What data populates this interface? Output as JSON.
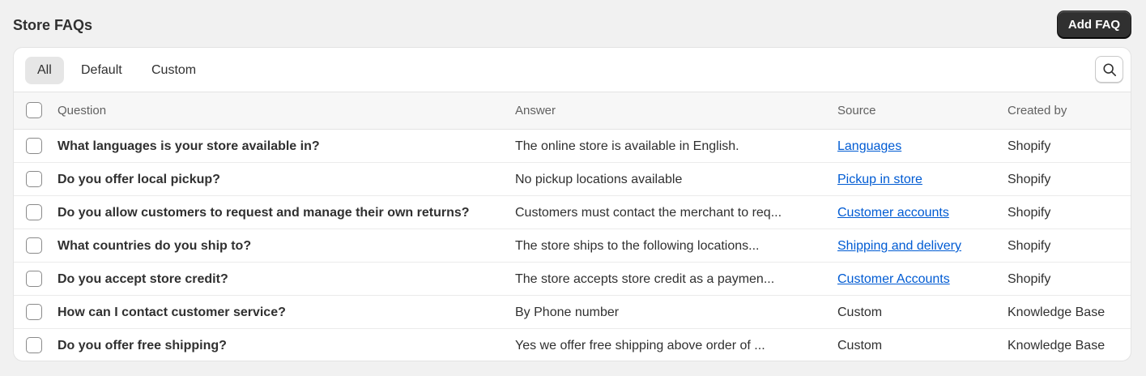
{
  "header": {
    "title": "Store FAQs",
    "add_button": "Add FAQ"
  },
  "tabs": [
    {
      "label": "All",
      "active": true
    },
    {
      "label": "Default",
      "active": false
    },
    {
      "label": "Custom",
      "active": false
    }
  ],
  "search": {
    "icon": "search-icon"
  },
  "table": {
    "columns": {
      "question": "Question",
      "answer": "Answer",
      "source": "Source",
      "created_by": "Created by"
    },
    "rows": [
      {
        "question": "What languages is your store available in?",
        "answer": "The online store is available in English.",
        "source": "Languages",
        "source_is_link": true,
        "created_by": "Shopify"
      },
      {
        "question": "Do you offer local pickup?",
        "answer": "No pickup locations available",
        "source": "Pickup in store",
        "source_is_link": true,
        "created_by": "Shopify"
      },
      {
        "question": "Do you allow customers to request and manage their own returns?",
        "answer": "Customers must contact the merchant to req...",
        "source": "Customer accounts",
        "source_is_link": true,
        "created_by": "Shopify"
      },
      {
        "question": "What countries do you ship to?",
        "answer": "The store ships to the following locations...",
        "source": "Shipping and delivery",
        "source_is_link": true,
        "created_by": "Shopify"
      },
      {
        "question": "Do you accept store credit?",
        "answer": "The store accepts store credit as a paymen...",
        "source": "Customer Accounts",
        "source_is_link": true,
        "created_by": "Shopify"
      },
      {
        "question": "How can I contact customer service?",
        "answer": "By Phone number",
        "source": "Custom",
        "source_is_link": false,
        "created_by": "Knowledge Base"
      },
      {
        "question": "Do you offer free shipping?",
        "answer": "Yes we offer free shipping above order of ...",
        "source": "Custom",
        "source_is_link": false,
        "created_by": "Knowledge Base"
      }
    ]
  },
  "colors": {
    "background": "#f1f1f1",
    "primary_button": "#303030",
    "link": "#005bd3"
  }
}
